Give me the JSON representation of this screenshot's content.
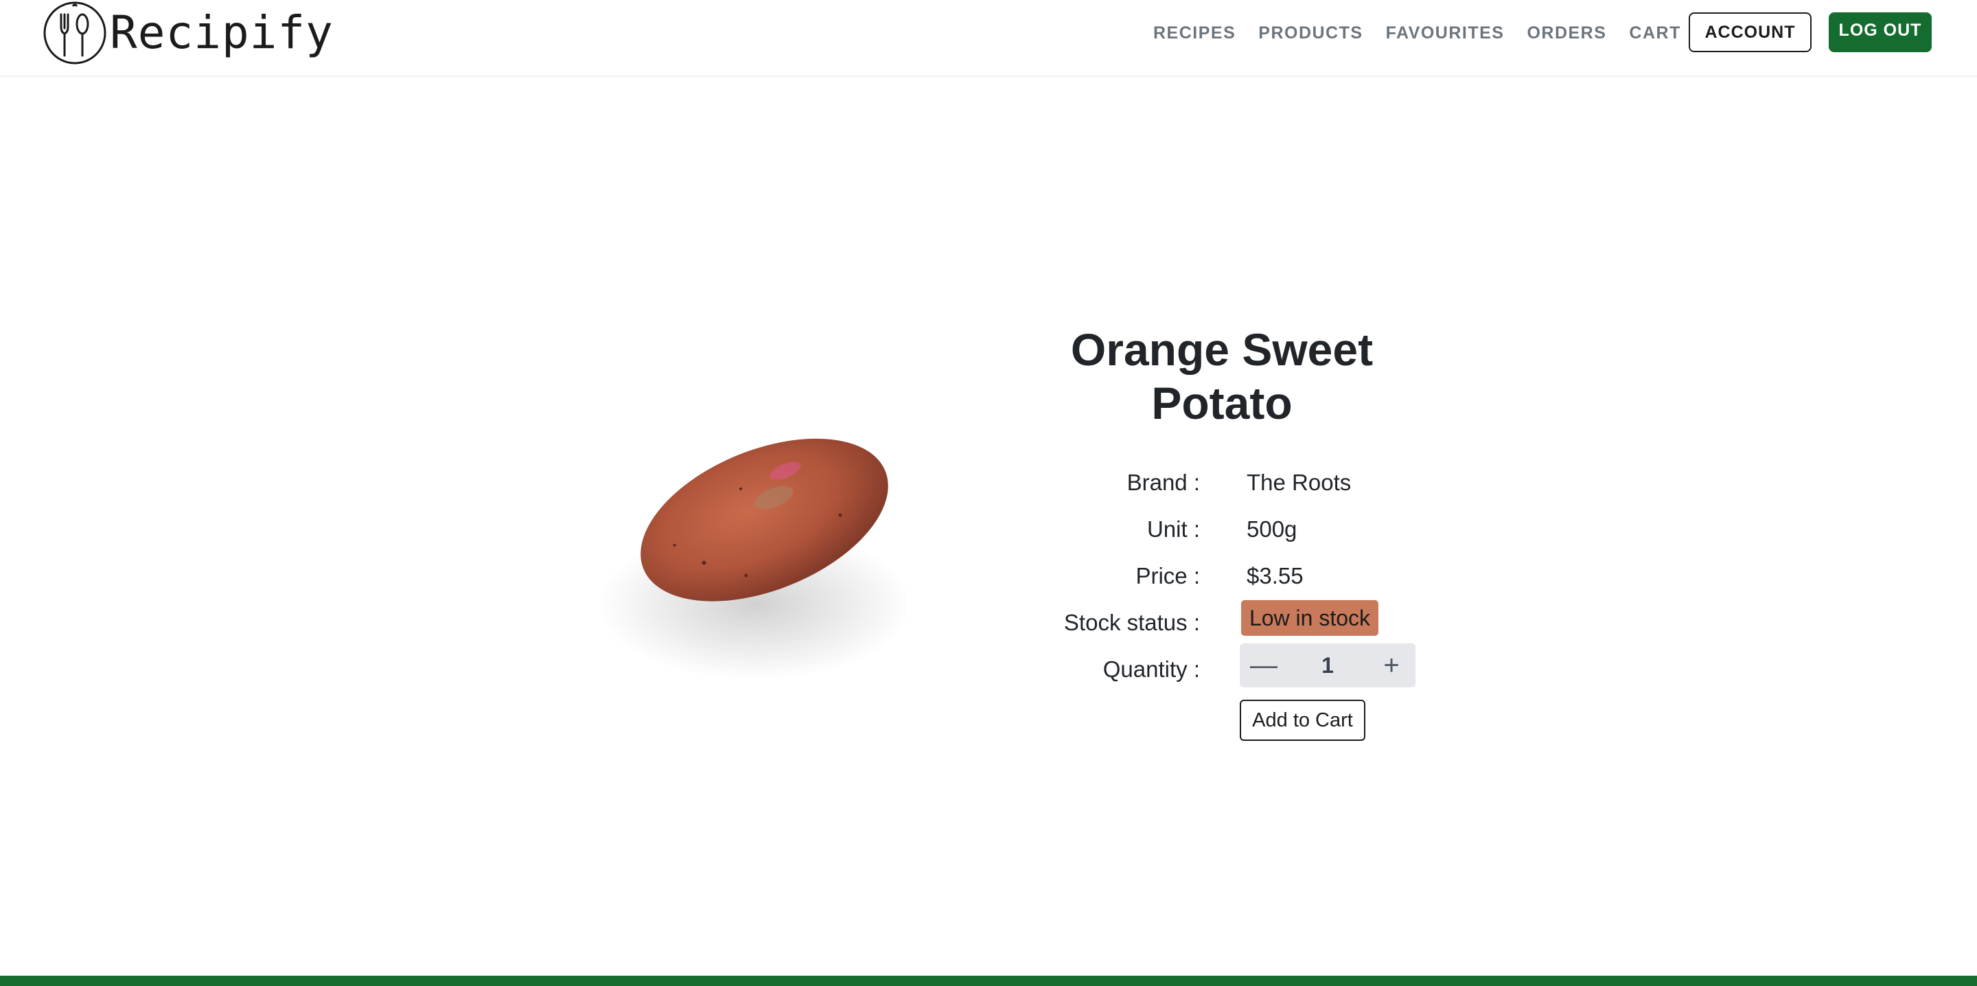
{
  "brand": {
    "name": "Recipify",
    "icon": "fork-spoon-logo-icon"
  },
  "nav": {
    "links": [
      {
        "label": "RECIPES"
      },
      {
        "label": "PRODUCTS"
      },
      {
        "label": "FAVOURITES"
      },
      {
        "label": "ORDERS"
      },
      {
        "label": "CART"
      }
    ],
    "account_label": "ACCOUNT",
    "logout_label": "LOG OUT"
  },
  "product": {
    "name_line1": "Orange Sweet",
    "name_line2": "Potato",
    "image_icon": "sweet-potato-image",
    "details": {
      "brand_label": "Brand :",
      "brand_value": "The Roots",
      "unit_label": "Unit :",
      "unit_value": "500g",
      "price_label": "Price :",
      "price_value": "$3.55",
      "stock_label": "Stock status :",
      "stock_value": "Low in stock",
      "quantity_label": "Quantity :"
    },
    "quantity": {
      "value": "1",
      "decrement_symbol": "—",
      "increment_symbol": "+"
    },
    "add_to_cart_label": "Add to Cart"
  },
  "colors": {
    "primary_green": "#146c2e",
    "stock_badge": "#c87a5b",
    "nav_text": "#6c757d",
    "stepper_bg": "#e5e7eb"
  }
}
